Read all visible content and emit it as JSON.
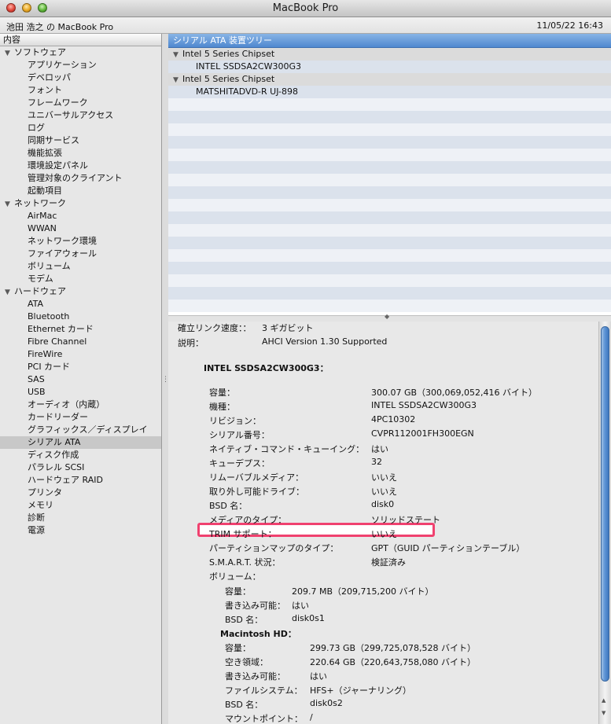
{
  "window": {
    "title": "MacBook Pro"
  },
  "infobar": {
    "computer_name": "池田 浩之 の MacBook Pro",
    "datetime": "11/05/22 16:43"
  },
  "sidebar": {
    "header": "内容",
    "categories": [
      {
        "label": "ソフトウェア",
        "items": [
          "アプリケーション",
          "デベロッパ",
          "フォント",
          "フレームワーク",
          "ユニバーサルアクセス",
          "ログ",
          "同期サービス",
          "機能拡張",
          "環境設定パネル",
          "管理対象のクライアント",
          "起動項目"
        ]
      },
      {
        "label": "ネットワーク",
        "items": [
          "AirMac",
          "WWAN",
          "ネットワーク環境",
          "ファイアウォール",
          "ボリューム",
          "モデム"
        ]
      },
      {
        "label": "ハードウェア",
        "items": [
          "ATA",
          "Bluetooth",
          "Ethernet カード",
          "Fibre Channel",
          "FireWire",
          "PCI カード",
          "SAS",
          "USB",
          "オーディオ（内蔵）",
          "カードリーダー",
          "グラフィックス／ディスプレイ",
          "シリアル ATA",
          "ディスク作成",
          "パラレル SCSI",
          "ハードウェア RAID",
          "プリンタ",
          "メモリ",
          "診断",
          "電源"
        ]
      }
    ],
    "selected": "シリアル ATA"
  },
  "tree": {
    "header": "シリアル ATA 装置ツリー",
    "rows": [
      {
        "type": "group",
        "label": "Intel 5 Series Chipset"
      },
      {
        "type": "device",
        "label": "INTEL SSDSA2CW300G3"
      },
      {
        "type": "group",
        "label": "Intel 5 Series Chipset"
      },
      {
        "type": "device",
        "label": "MATSHITADVD-R   UJ-898"
      }
    ],
    "empty_rows": 17
  },
  "detail": {
    "link_speed_label": "確立リンク速度：：",
    "link_speed_value": "3 ギガビット",
    "desc_label": "説明：",
    "desc_value": "AHCI Version 1.30 Supported",
    "device_title": "INTEL SSDSA2CW300G3：",
    "props": [
      {
        "k": "容量：",
        "v": "300.07 GB（300,069,052,416 バイト）"
      },
      {
        "k": "機種：",
        "v": "INTEL SSDSA2CW300G3"
      },
      {
        "k": "リビジョン：",
        "v": "4PC10302"
      },
      {
        "k": "シリアル番号：",
        "v": "CVPR112001FH300EGN"
      },
      {
        "k": "ネイティブ・コマンド・キューイング：",
        "v": "はい"
      },
      {
        "k": "キューデプス：",
        "v": "32"
      },
      {
        "k": "リムーバブルメディア：",
        "v": "いいえ"
      },
      {
        "k": "取り外し可能ドライブ：",
        "v": "いいえ"
      },
      {
        "k": "BSD 名：",
        "v": "disk0"
      },
      {
        "k": "メディアのタイプ：",
        "v": "ソリッドステート"
      },
      {
        "k": "TRIM サポート：",
        "v": "いいえ"
      },
      {
        "k": "パーティションマップのタイプ：",
        "v": "GPT（GUID パーティションテーブル）"
      },
      {
        "k": "S.M.A.R.T. 状況：",
        "v": "検証済み"
      },
      {
        "k": "ボリューム：",
        "v": ""
      }
    ],
    "vol1": [
      {
        "k": "容量：",
        "v": "209.7 MB（209,715,200 バイト）"
      },
      {
        "k": "書き込み可能：",
        "v": "はい"
      },
      {
        "k": "BSD 名：",
        "v": "disk0s1"
      }
    ],
    "vol2_title": "Macintosh HD：",
    "vol2": [
      {
        "k": "容量：",
        "v": "299.73 GB（299,725,078,528 バイト）"
      },
      {
        "k": "空き領域：",
        "v": "220.64 GB（220,643,758,080 バイト）"
      },
      {
        "k": "書き込み可能：",
        "v": "はい"
      },
      {
        "k": "ファイルシステム：",
        "v": "HFS+（ジャーナリング）"
      },
      {
        "k": "BSD 名：",
        "v": "disk0s2"
      },
      {
        "k": "マウントポイント：",
        "v": "/"
      }
    ]
  },
  "colors": {
    "highlight": "#f0416f",
    "tree_header": "#4f88cf"
  }
}
